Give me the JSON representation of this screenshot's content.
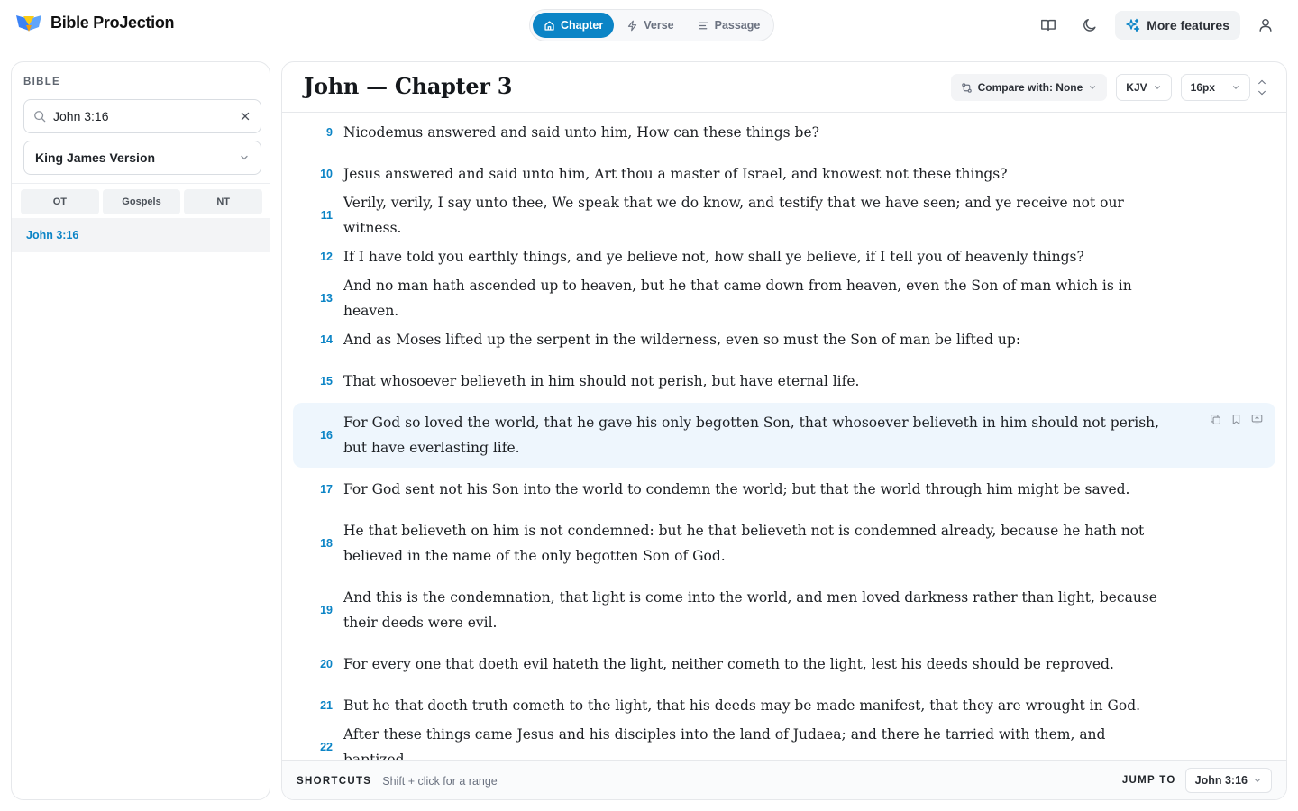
{
  "app": {
    "name": "Bible ProJection"
  },
  "modes": [
    {
      "label": "Chapter",
      "icon": "home-icon",
      "active": true
    },
    {
      "label": "Verse",
      "icon": "bolt-icon",
      "active": false
    },
    {
      "label": "Passage",
      "icon": "lines-icon",
      "active": false
    }
  ],
  "topbar": {
    "more_label": "More features"
  },
  "sidebar": {
    "title": "BIBLE",
    "search_value": "John 3:16",
    "version": "King James Version",
    "filters": [
      "OT",
      "Gospels",
      "NT"
    ],
    "result": "John 3:16"
  },
  "main": {
    "title": "John — Chapter 3",
    "compare": "Compare with: None",
    "translation": "KJV",
    "font_size": "16px"
  },
  "verses": [
    {
      "n": "9",
      "text": "Nicodemus answered and said unto him, How can these things be?"
    },
    {
      "n": "10",
      "text": "Jesus answered and said unto him, Art thou a master of Israel, and knowest not these things?"
    },
    {
      "n": "11",
      "text": "Verily, verily, I say unto thee, We speak that we do know, and testify that we have seen; and ye receive not our witness."
    },
    {
      "n": "12",
      "text": "If I have told you earthly things, and ye believe not, how shall ye believe, if I tell you of heavenly things?"
    },
    {
      "n": "13",
      "text": "And no man hath ascended up to heaven, but he that came down from heaven, even the Son of man which is in heaven."
    },
    {
      "n": "14",
      "text": "And as Moses lifted up the serpent in the wilderness, even so must the Son of man be lifted up:"
    },
    {
      "n": "15",
      "text": "That whosoever believeth in him should not perish, but have eternal life."
    },
    {
      "n": "16",
      "text": "For God so loved the world, that he gave his only begotten Son, that whosoever believeth in him should not perish, but have everlasting life.",
      "highlighted": true
    },
    {
      "n": "17",
      "text": "For God sent not his Son into the world to condemn the world; but that the world through him might be saved."
    },
    {
      "n": "18",
      "text": "He that believeth on him is not condemned: but he that believeth not is condemned already, because he hath not believed in the name of the only begotten Son of God."
    },
    {
      "n": "19",
      "text": "And this is the condemnation, that light is come into the world, and men loved darkness rather than light, because their deeds were evil."
    },
    {
      "n": "20",
      "text": "For every one that doeth evil hateth the light, neither cometh to the light, lest his deeds should be reproved."
    },
    {
      "n": "21",
      "text": "But he that doeth truth cometh to the light, that his deeds may be made manifest, that they are wrought in God."
    },
    {
      "n": "22",
      "text": "After these things came Jesus and his disciples into the land of Judaea; and there he tarried with them, and baptized."
    }
  ],
  "footer": {
    "shortcuts_label": "SHORTCUTS",
    "shortcuts_text": "Shift + click for a range",
    "jump_label": "JUMP TO",
    "jump_value": "John 3:16"
  },
  "colors": {
    "accent": "#0b84c6",
    "highlight": "#eef6fd",
    "logo_blue": "#3b82f6",
    "logo_yellow": "#facc15"
  }
}
